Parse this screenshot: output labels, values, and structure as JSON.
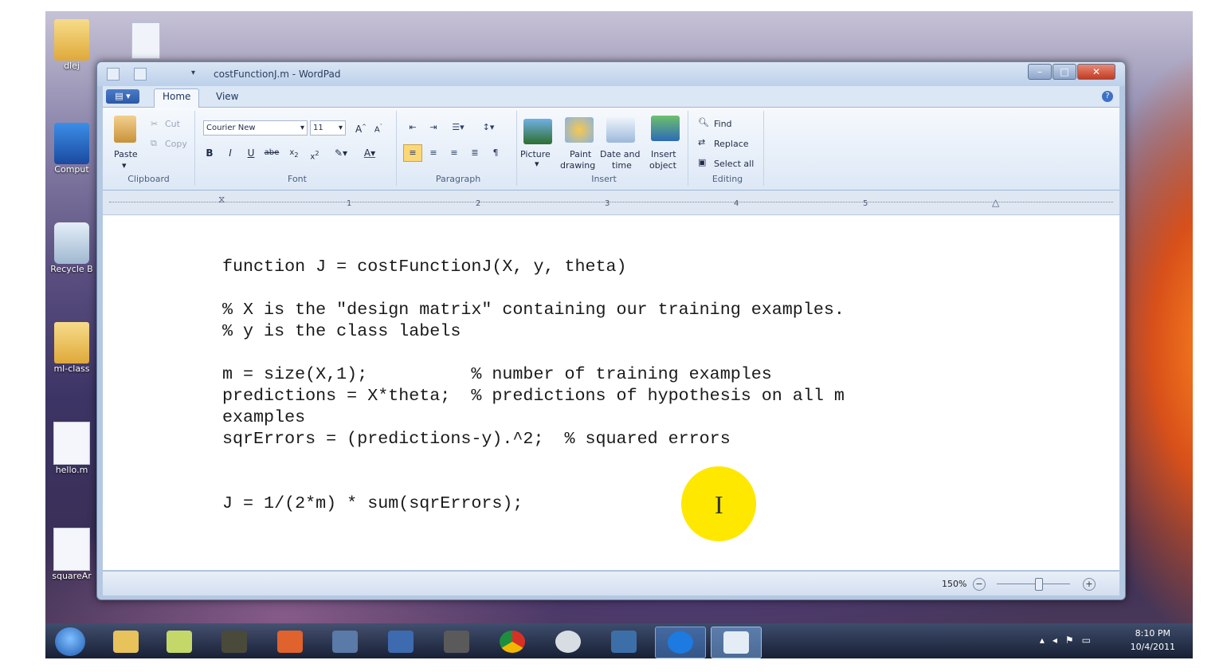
{
  "desktop_icons": [
    {
      "name": "user-folder",
      "label": "dlej"
    },
    {
      "name": "computer",
      "label": "Comput"
    },
    {
      "name": "recycle-bin",
      "label": "Recycle B"
    },
    {
      "name": "ml-class-folder",
      "label": "ml-class"
    },
    {
      "name": "hello-m",
      "label": "hello.m"
    },
    {
      "name": "square-file",
      "label": "squareAr"
    }
  ],
  "window": {
    "title": "costFunctionJ.m - WordPad"
  },
  "ribbon": {
    "tabs": [
      "Home",
      "View"
    ],
    "clipboard": {
      "paste": "Paste",
      "cut": "Cut",
      "copy": "Copy",
      "label": "Clipboard"
    },
    "font": {
      "family": "Courier New",
      "size": "11",
      "label": "Font",
      "bold": "B",
      "italic": "I",
      "underline": "U",
      "strike": "abe"
    },
    "paragraph": {
      "label": "Paragraph"
    },
    "insert": {
      "picture": "Picture",
      "paint_line1": "Paint",
      "paint_line2": "drawing",
      "datetime_line1": "Date and",
      "datetime_line2": "time",
      "object_line1": "Insert",
      "object_line2": "object",
      "label": "Insert"
    },
    "editing": {
      "find": "Find",
      "replace": "Replace",
      "select_all": "Select all",
      "label": "Editing"
    }
  },
  "ruler": {
    "marks": [
      "1",
      "2",
      "3",
      "4",
      "5"
    ]
  },
  "document": {
    "lines": [
      "function J = costFunctionJ(X, y, theta)",
      "",
      "% X is the \"design matrix\" containing our training examples.",
      "% y is the class labels",
      "",
      "m = size(X,1);          % number of training examples",
      "predictions = X*theta;  % predictions of hypothesis on all m",
      "examples",
      "sqrErrors = (predictions-y).^2;  % squared errors",
      "",
      "",
      "J = 1/(2*m) * sum(sqrErrors);"
    ]
  },
  "status": {
    "zoom": "150%"
  },
  "taskbar": {
    "apps": [
      "start",
      "explorer",
      "notes",
      "media",
      "powerpoint",
      "network",
      "remote",
      "camera",
      "chrome",
      "webcam",
      "python",
      "app-blue",
      "wordpad"
    ],
    "time": "8:10 PM",
    "date": "10/4/2011"
  },
  "colors": {
    "accent": "#2c59a8",
    "highlight": "#ffe800"
  }
}
